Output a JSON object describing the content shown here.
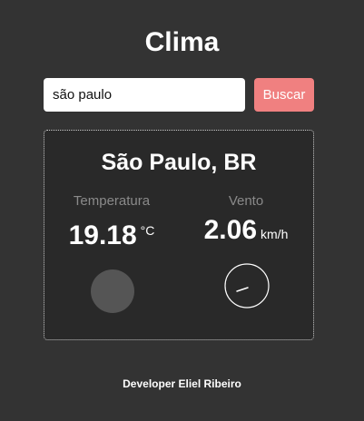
{
  "app": {
    "title": "Clima"
  },
  "search": {
    "value": "são paulo",
    "button_label": "Buscar"
  },
  "weather": {
    "city": "São Paulo, BR",
    "temperature": {
      "label": "Temperatura",
      "value": "19.18",
      "unit": "°C"
    },
    "wind": {
      "label": "Vento",
      "value": "2.06",
      "unit": "km/h"
    }
  },
  "footer": {
    "credit": "Developer Eliel Ribeiro"
  },
  "colors": {
    "background": "#333333",
    "card": "#292929",
    "accent_button": "#f08080",
    "muted_label": "#8a8a8a"
  },
  "icons": {
    "temperature_indicator": "filled-circle",
    "wind_direction": "compass-needle-icon"
  }
}
